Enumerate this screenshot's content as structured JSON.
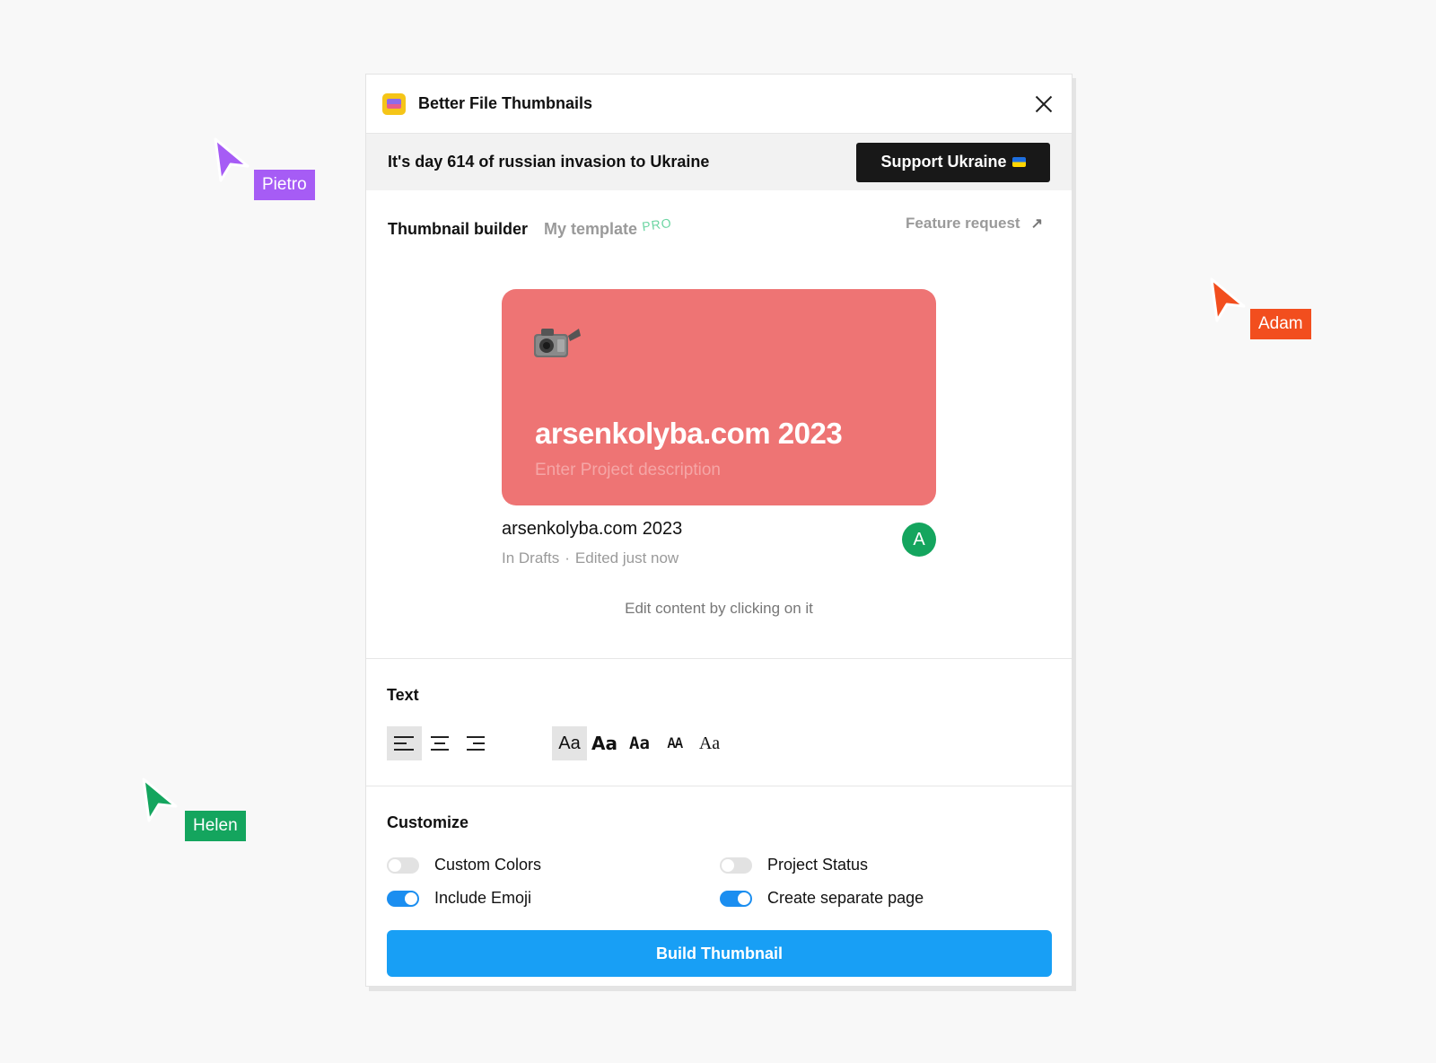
{
  "plugin": {
    "title": "Better File Thumbnails",
    "icon": "app-icon"
  },
  "banner": {
    "text": "It's day 614 of russian invasion to Ukraine",
    "button_label": "Support Ukraine"
  },
  "tabs": {
    "active": "Thumbnail builder",
    "inactive": "My template",
    "badge": "PRO",
    "feature_request": "Feature request"
  },
  "preview": {
    "thumb_title": "arsenkolyba.com 2023",
    "thumb_description": "Enter Project description",
    "thumb_color": "#ee7474",
    "emoji": "video-camera-emoji",
    "file_name": "arsenkolyba.com 2023",
    "file_location": "In Drafts",
    "file_edited": "Edited just now",
    "avatar_letter": "A",
    "hint": "Edit content by clicking on it"
  },
  "text_section": {
    "title": "Text",
    "alignments": [
      "left",
      "center",
      "right"
    ],
    "selected_alignment": "left",
    "font_samples": [
      "Aa",
      "Aa",
      "Aa",
      "AA",
      "Aa"
    ],
    "selected_font_index": 0
  },
  "customize": {
    "title": "Customize",
    "options": [
      {
        "label": "Custom Colors",
        "on": false
      },
      {
        "label": "Project Status",
        "on": false
      },
      {
        "label": "Include Emoji",
        "on": true
      },
      {
        "label": "Create separate page",
        "on": true
      }
    ],
    "build_label": "Build Thumbnail"
  },
  "cursors": [
    {
      "name": "Pietro",
      "color": "#a65cf5"
    },
    {
      "name": "Adam",
      "color": "#f24e1e"
    },
    {
      "name": "Helen",
      "color": "#14a55e"
    }
  ]
}
